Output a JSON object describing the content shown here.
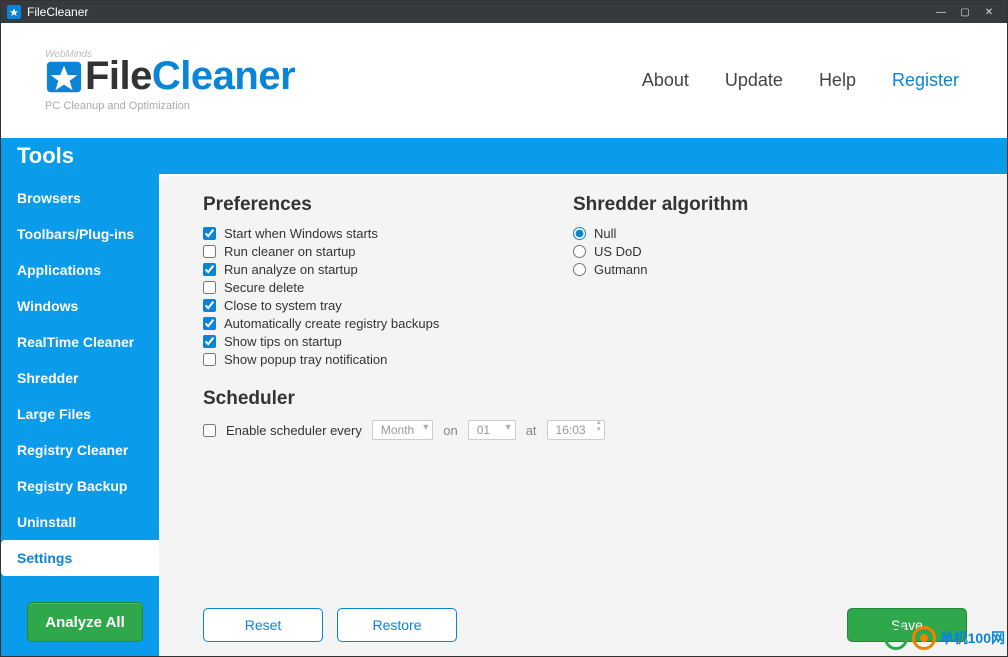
{
  "window": {
    "title": "FileCleaner"
  },
  "logo": {
    "brand": "WebMinds",
    "name_a": "File",
    "name_b": "Cleaner",
    "sub": "PC Cleanup and Optimization"
  },
  "nav": {
    "about": "About",
    "update": "Update",
    "help": "Help",
    "register": "Register"
  },
  "tools_label": "Tools",
  "sidebar": {
    "items": [
      {
        "label": "Browsers"
      },
      {
        "label": "Toolbars/Plug-ins"
      },
      {
        "label": "Applications"
      },
      {
        "label": "Windows"
      },
      {
        "label": "RealTime Cleaner"
      },
      {
        "label": "Shredder"
      },
      {
        "label": "Large Files"
      },
      {
        "label": "Registry Cleaner"
      },
      {
        "label": "Registry Backup"
      },
      {
        "label": "Uninstall"
      },
      {
        "label": "Settings"
      }
    ],
    "active_index": 10,
    "analyze": "Analyze All"
  },
  "prefs": {
    "title": "Preferences",
    "items": [
      {
        "label": "Start when Windows starts",
        "checked": true
      },
      {
        "label": "Run cleaner on startup",
        "checked": false
      },
      {
        "label": "Run analyze on startup",
        "checked": true
      },
      {
        "label": "Secure delete",
        "checked": false
      },
      {
        "label": "Close to system tray",
        "checked": true
      },
      {
        "label": "Automatically create registry backups",
        "checked": true
      },
      {
        "label": "Show tips on startup",
        "checked": true
      },
      {
        "label": "Show popup tray notification",
        "checked": false
      }
    ]
  },
  "shredder": {
    "title": "Shredder algorithm",
    "options": [
      {
        "label": "Null",
        "selected": true
      },
      {
        "label": "US DoD",
        "selected": false
      },
      {
        "label": "Gutmann",
        "selected": false
      }
    ]
  },
  "scheduler": {
    "title": "Scheduler",
    "enable_label": "Enable scheduler every",
    "period": "Month",
    "on_label": "on",
    "day": "01",
    "at_label": "at",
    "time": "16:03",
    "enabled": false
  },
  "buttons": {
    "reset": "Reset",
    "restore": "Restore",
    "save": "Save"
  },
  "watermark": "单机100网"
}
